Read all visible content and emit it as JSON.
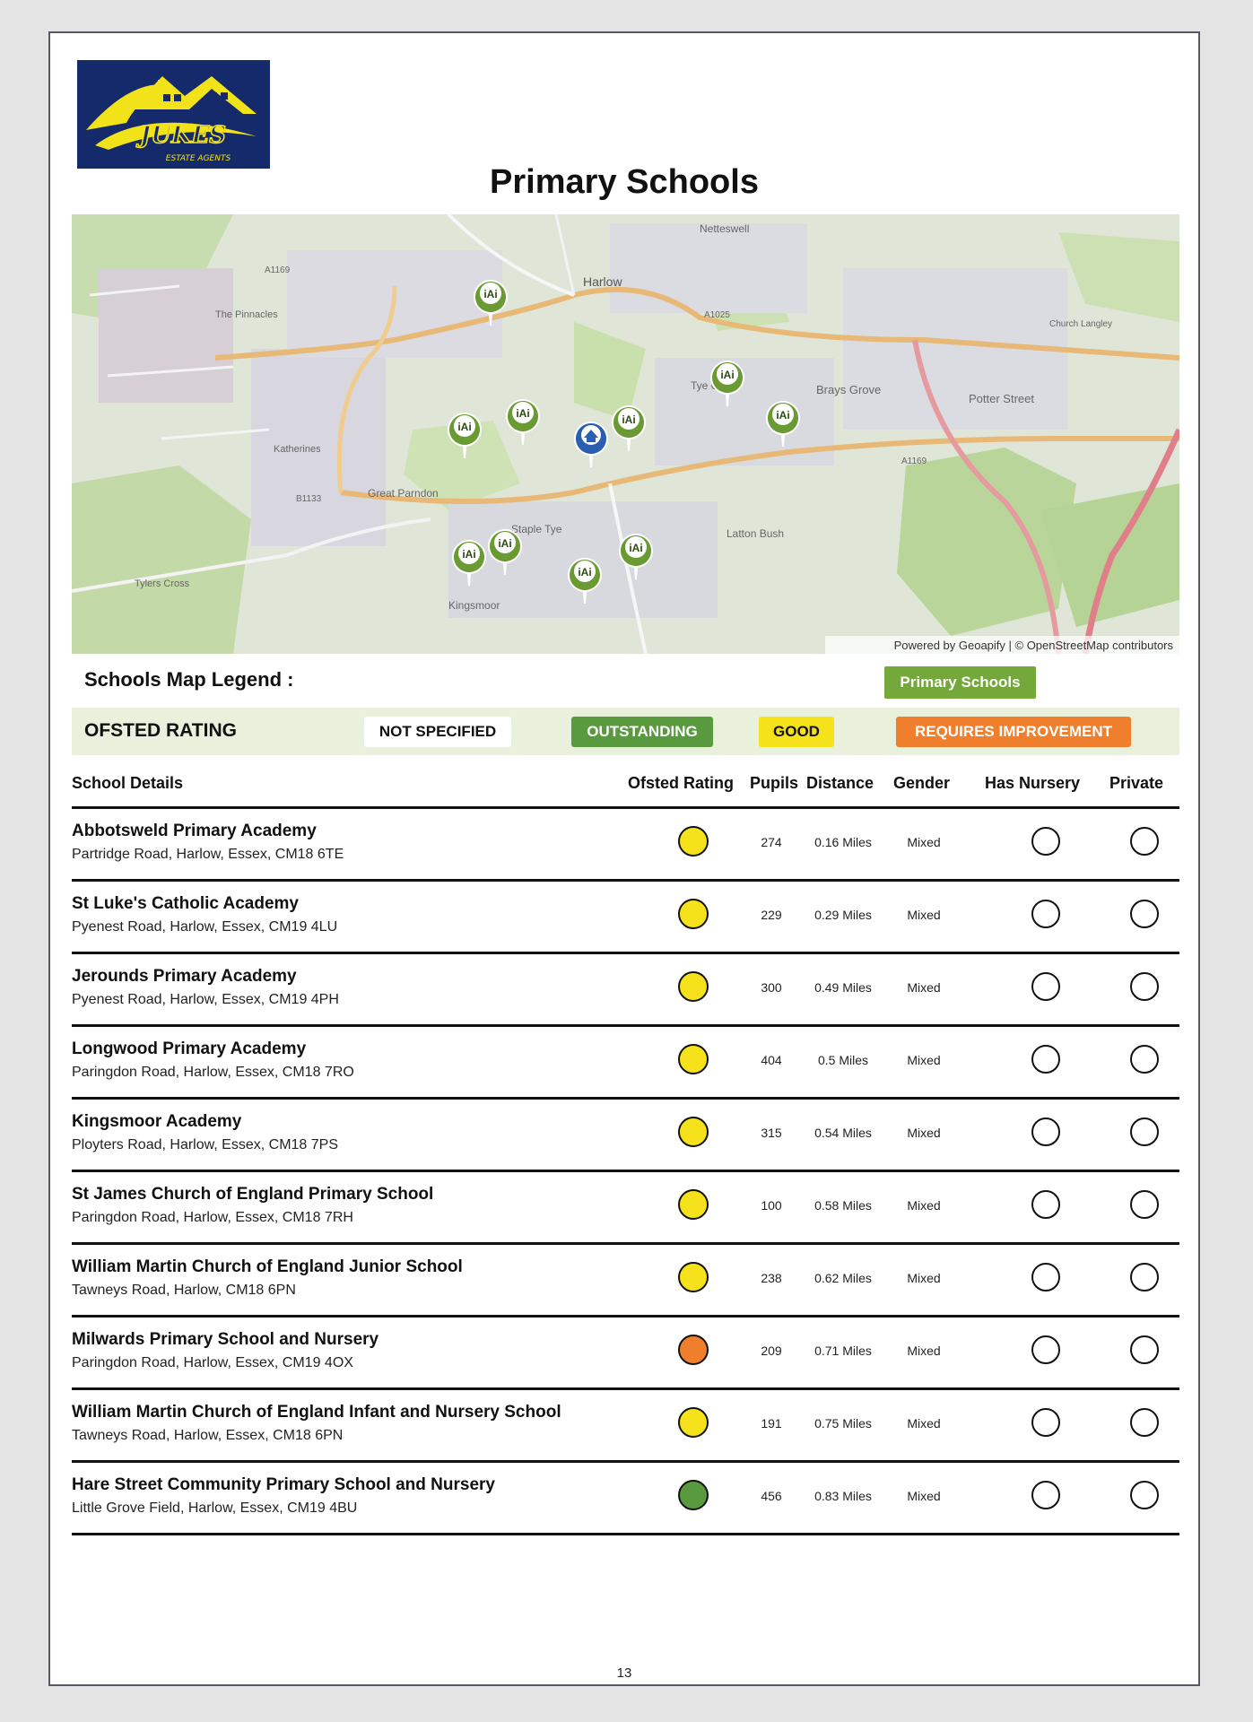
{
  "logo": {
    "text_main": "JUKES",
    "text_sub": "ESTATE AGENTS"
  },
  "title": "Primary Schools",
  "map": {
    "attribution": "Powered by Geoapify | © OpenStreetMap contributors",
    "place_labels": [
      "Harlow",
      "Netteswell",
      "Brays Grove",
      "Potter Street",
      "Great Parndon",
      "Staple Tye",
      "Latton Bush",
      "Kingsmoor",
      "Tye Green",
      "The Pinnacles",
      "Katherines",
      "Tylers Cross",
      "Church Langley"
    ],
    "road_labels": [
      "A1169",
      "A1025",
      "B1133",
      "A1169"
    ]
  },
  "legend": {
    "label": "Schools Map Legend :",
    "primary_schools": "Primary Schools"
  },
  "ofsted": {
    "title": "OFSTED RATING",
    "not_specified": "NOT SPECIFIED",
    "outstanding": "OUTSTANDING",
    "good": "GOOD",
    "requires_improvement": "REQUIRES IMPROVEMENT"
  },
  "colors": {
    "good": "#f6e21a",
    "outstanding": "#5a9a3f",
    "requires_improvement": "#ef7f2d",
    "map_pin": "#6a9a32",
    "home_pin": "#2a5eb0"
  },
  "table": {
    "headers": {
      "details": "School Details",
      "ofsted": "Ofsted Rating",
      "pupils": "Pupils",
      "distance": "Distance",
      "gender": "Gender",
      "nursery": "Has Nursery",
      "private": "Private"
    },
    "rows": [
      {
        "name": "Abbotsweld Primary Academy",
        "address": "Partridge Road, Harlow, Essex, CM18 6TE",
        "rating": "good",
        "pupils": "274",
        "distance": "0.16 Miles",
        "gender": "Mixed"
      },
      {
        "name": "St Luke's Catholic Academy",
        "address": "Pyenest Road, Harlow, Essex, CM19 4LU",
        "rating": "good",
        "pupils": "229",
        "distance": "0.29 Miles",
        "gender": "Mixed"
      },
      {
        "name": "Jerounds Primary Academy",
        "address": "Pyenest Road, Harlow, Essex, CM19 4PH",
        "rating": "good",
        "pupils": "300",
        "distance": "0.49 Miles",
        "gender": "Mixed"
      },
      {
        "name": "Longwood Primary Academy",
        "address": "Paringdon Road, Harlow, Essex, CM18 7RO",
        "rating": "good",
        "pupils": "404",
        "distance": "0.5 Miles",
        "gender": "Mixed"
      },
      {
        "name": "Kingsmoor Academy",
        "address": "Ployters Road, Harlow, Essex, CM18 7PS",
        "rating": "good",
        "pupils": "315",
        "distance": "0.54 Miles",
        "gender": "Mixed"
      },
      {
        "name": "St James Church of England Primary School",
        "address": "Paringdon Road, Harlow, Essex, CM18 7RH",
        "rating": "good",
        "pupils": "100",
        "distance": "0.58 Miles",
        "gender": "Mixed"
      },
      {
        "name": "William Martin Church of England Junior School",
        "address": "Tawneys Road, Harlow, CM18 6PN",
        "rating": "good",
        "pupils": "238",
        "distance": "0.62 Miles",
        "gender": "Mixed"
      },
      {
        "name": "Milwards Primary School and Nursery",
        "address": "Paringdon Road, Harlow, Essex, CM19 4OX",
        "rating": "requires_improvement",
        "pupils": "209",
        "distance": "0.71 Miles",
        "gender": "Mixed"
      },
      {
        "name": "William Martin Church of England Infant and Nursery School",
        "address": "Tawneys Road, Harlow, Essex, CM18 6PN",
        "rating": "good",
        "pupils": "191",
        "distance": "0.75 Miles",
        "gender": "Mixed"
      },
      {
        "name": "Hare Street Community Primary School and Nursery",
        "address": "Little Grove Field, Harlow, Essex, CM19 4BU",
        "rating": "outstanding",
        "pupils": "456",
        "distance": "0.83 Miles",
        "gender": "Mixed"
      }
    ]
  },
  "page_number": "13"
}
